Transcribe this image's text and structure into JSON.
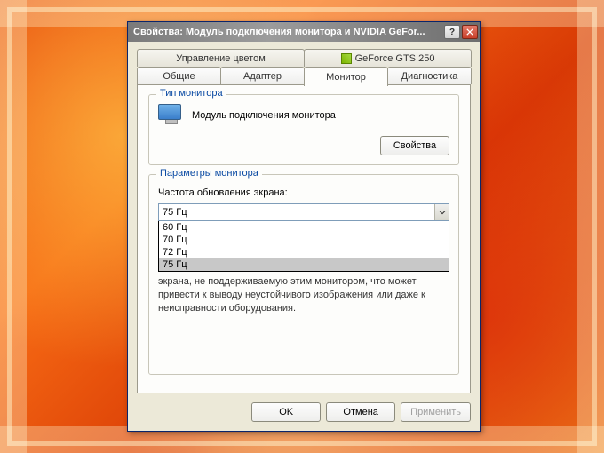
{
  "window": {
    "title": "Свойства: Модуль подключения монитора и NVIDIA GeFor..."
  },
  "tabs": {
    "row1": [
      "Управление цветом",
      "GeForce GTS 250"
    ],
    "row2": [
      "Общие",
      "Адаптер",
      "Монитор",
      "Диагностика"
    ],
    "active": "Монитор"
  },
  "group_type": {
    "title": "Тип монитора",
    "device_name": "Модуль подключения монитора",
    "properties_btn": "Свойства"
  },
  "group_params": {
    "title": "Параметры монитора",
    "freq_label": "Частота обновления экрана:",
    "selected": "75 Гц",
    "options": [
      "60 Гц",
      "70 Гц",
      "72 Гц",
      "75 Гц"
    ],
    "hidden_note": "экрана, не поддерживаемую этим монитором, что может привести к выводу неустойчивого изображения или даже к неисправности оборудования."
  },
  "buttons": {
    "ok": "OK",
    "cancel": "Отмена",
    "apply": "Применить"
  }
}
